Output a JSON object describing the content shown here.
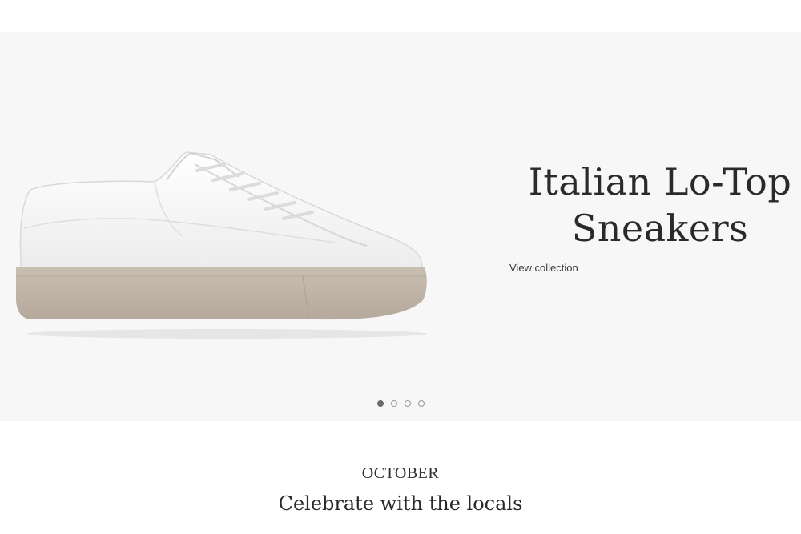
{
  "hero": {
    "title_line1": "Italian Lo-Top",
    "title_line2": "Sneakers",
    "link_label": "View collection",
    "image_icon": "white-leather-sneaker",
    "background": "#f7f7f7",
    "slides": {
      "count": 4,
      "active": 1
    }
  },
  "section": {
    "kicker": "OCTOBER",
    "title": "Celebrate with the locals"
  }
}
